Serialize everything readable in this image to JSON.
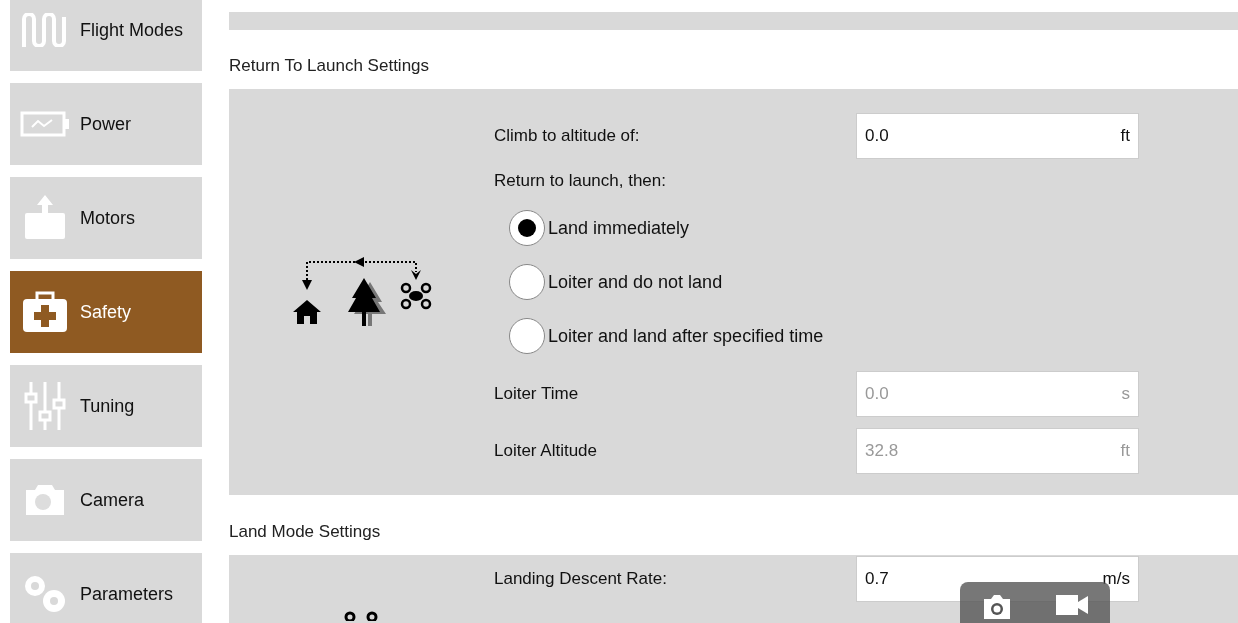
{
  "sidebar": {
    "items": [
      {
        "label": "Flight Modes",
        "kind": "modes",
        "selected": false
      },
      {
        "label": "Power",
        "kind": "power",
        "selected": false
      },
      {
        "label": "Motors",
        "kind": "motors",
        "selected": false
      },
      {
        "label": "Safety",
        "kind": "safety",
        "selected": true
      },
      {
        "label": "Tuning",
        "kind": "tuning",
        "selected": false
      },
      {
        "label": "Camera",
        "kind": "camera",
        "selected": false
      },
      {
        "label": "Parameters",
        "kind": "parameters",
        "selected": false
      }
    ]
  },
  "rtl_section": {
    "title": "Return To Launch Settings",
    "climb": {
      "label": "Climb to altitude of:",
      "value": "0.0",
      "unit": "ft",
      "disabled": false
    },
    "then_label": "Return to launch, then:",
    "options": [
      {
        "label": "Land immediately",
        "selected": true
      },
      {
        "label": "Loiter and do not land",
        "selected": false
      },
      {
        "label": "Loiter and land after specified time",
        "selected": false
      }
    ],
    "fields": [
      {
        "label": "Loiter Time",
        "value": "0.0",
        "unit": "s",
        "disabled": true
      },
      {
        "label": "Loiter Altitude",
        "value": "32.8",
        "unit": "ft",
        "disabled": true
      }
    ]
  },
  "land_section": {
    "title": "Land Mode Settings",
    "fields": [
      {
        "label": "Landing Descent Rate:",
        "value": "0.7",
        "unit": "m/s",
        "disabled": false
      }
    ]
  }
}
